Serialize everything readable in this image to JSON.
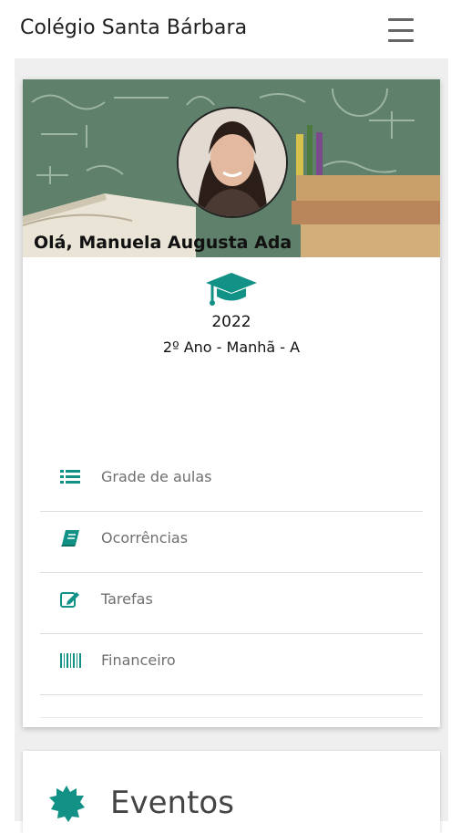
{
  "header": {
    "title": "Colégio Santa Bárbara",
    "menu_icon": "hamburger-menu-icon"
  },
  "profile": {
    "greeting": "Olá, Manuela Augusta Ada",
    "year": "2022",
    "class_info": "2º Ano - Manhã - A",
    "grad_icon": "graduation-cap-icon"
  },
  "menu": {
    "items": [
      {
        "label": "Grade de aulas",
        "icon": "list-icon"
      },
      {
        "label": "Ocorrências",
        "icon": "book-icon"
      },
      {
        "label": "Tarefas",
        "icon": "edit-icon"
      },
      {
        "label": "Financeiro",
        "icon": "barcode-icon"
      }
    ]
  },
  "events": {
    "title": "Eventos",
    "icon": "certificate-icon"
  },
  "colors": {
    "accent": "#129186",
    "menu_text": "#6f6f6f"
  }
}
